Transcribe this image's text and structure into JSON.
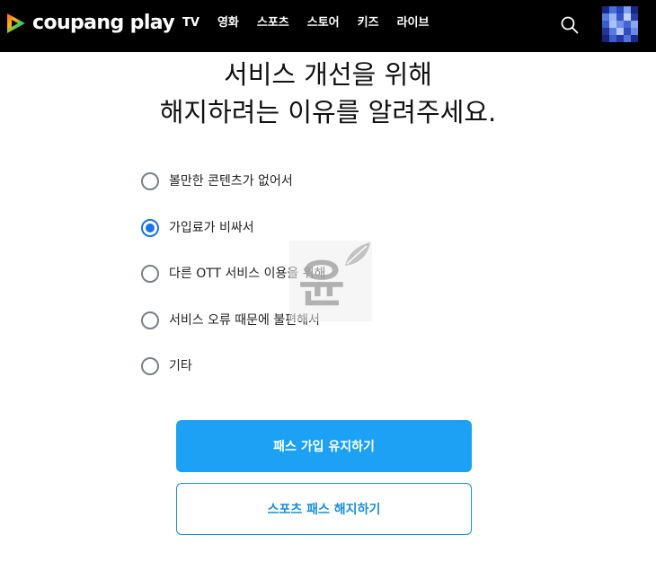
{
  "header": {
    "logo_text": "coupang play",
    "nav": [
      "TV",
      "영화",
      "스포츠",
      "스토어",
      "키즈",
      "라이브"
    ],
    "search_icon": "search-icon",
    "avatar_icon": "avatar"
  },
  "title": {
    "line1": "서비스 개선을 위해",
    "line2": "해지하려는 이유를 알려주세요."
  },
  "options": [
    {
      "label": "볼만한 콘텐츠가 없어서",
      "selected": false
    },
    {
      "label": "가입료가 비싸서",
      "selected": true
    },
    {
      "label": "다른 OTT 서비스 이용을 위해",
      "selected": false
    },
    {
      "label": "서비스 오류 때문에 불편해서",
      "selected": false
    },
    {
      "label": "기타",
      "selected": false
    }
  ],
  "buttons": {
    "keep": "패스 가입 유지하기",
    "cancel": "스포츠 패스 해지하기"
  },
  "watermark": {
    "text": "윤"
  },
  "colors": {
    "header_bg": "#000000",
    "accent": "#1da1f5",
    "radio_selected": "#1a73e8"
  }
}
